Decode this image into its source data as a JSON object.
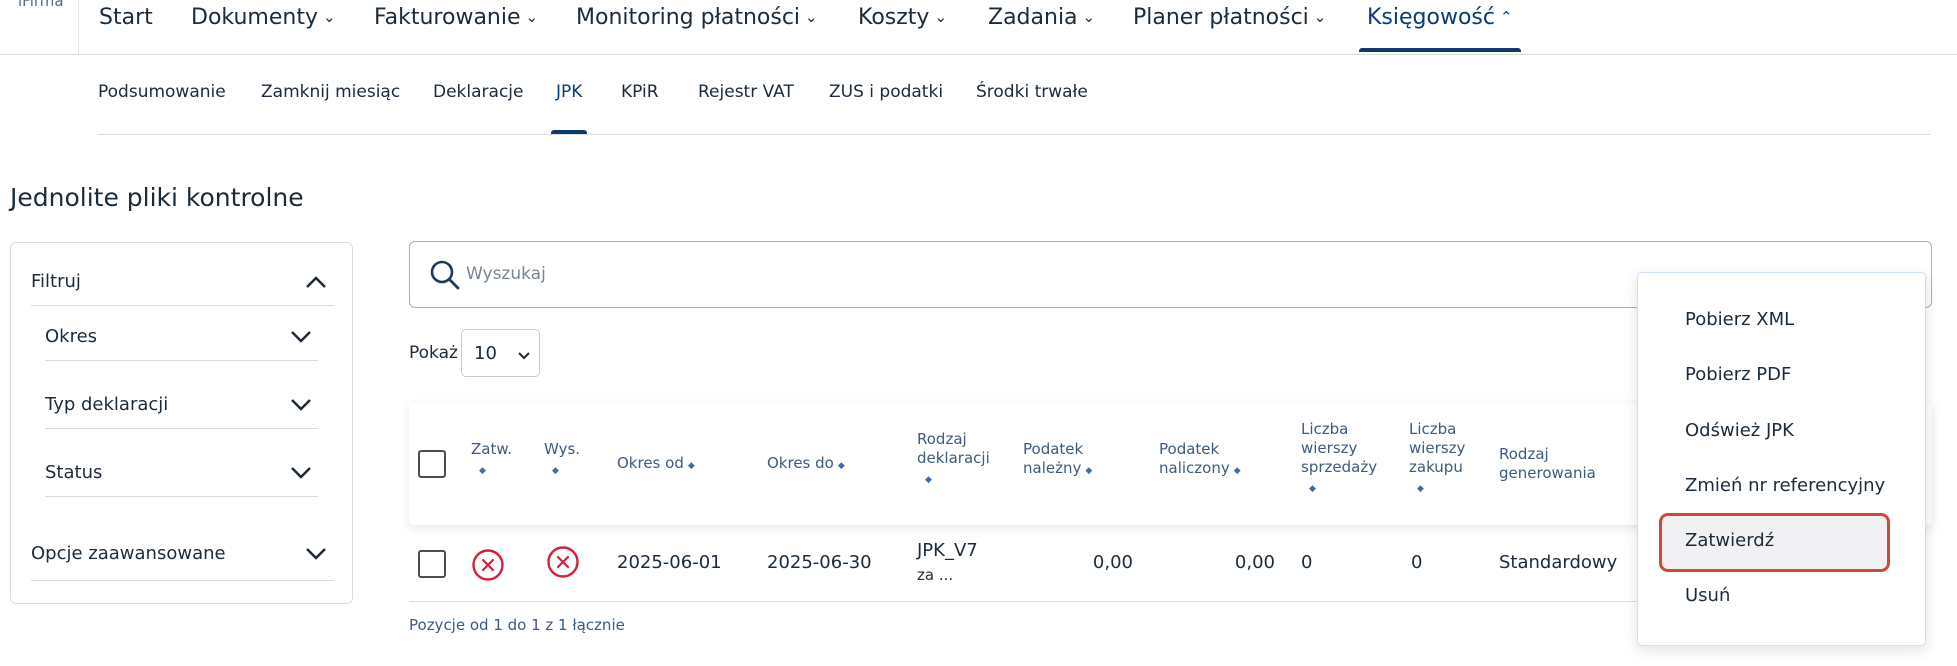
{
  "brand": {
    "text": "iFirma"
  },
  "top_nav": [
    {
      "label": "Start",
      "has_chevron": false
    },
    {
      "label": "Dokumenty",
      "has_chevron": true
    },
    {
      "label": "Fakturowanie",
      "has_chevron": true
    },
    {
      "label": "Monitoring płatności",
      "has_chevron": true
    },
    {
      "label": "Koszty",
      "has_chevron": true
    },
    {
      "label": "Zadania",
      "has_chevron": true
    },
    {
      "label": "Planer płatności",
      "has_chevron": true
    },
    {
      "label": "Księgowość",
      "has_chevron": true,
      "active": true
    }
  ],
  "sub_nav": [
    {
      "label": "Podsumowanie"
    },
    {
      "label": "Zamknij miesiąc"
    },
    {
      "label": "Deklaracje"
    },
    {
      "label": "JPK",
      "active": true
    },
    {
      "label": "KPiR"
    },
    {
      "label": "Rejestr VAT"
    },
    {
      "label": "ZUS i podatki"
    },
    {
      "label": "Środki trwałe"
    }
  ],
  "page_title": "Jednolite pliki kontrolne",
  "filter": {
    "title": "Filtruj",
    "items": [
      {
        "label": "Okres"
      },
      {
        "label": "Typ deklaracji"
      },
      {
        "label": "Status"
      }
    ],
    "advanced": "Opcje zaawansowane"
  },
  "search": {
    "placeholder": "Wyszukaj",
    "value": ""
  },
  "page_size": {
    "label": "Pokaż",
    "value": "10"
  },
  "table": {
    "columns": [
      {
        "label": "Zatw.",
        "sortable": true
      },
      {
        "label": "Wys.",
        "sortable": true
      },
      {
        "label": "Okres od",
        "sortable": true
      },
      {
        "label": "Okres do",
        "sortable": true
      },
      {
        "label": "Rodzaj deklaracji",
        "sortable": true
      },
      {
        "label": "Podatek należny",
        "sortable": true
      },
      {
        "label": "Podatek naliczony",
        "sortable": true
      },
      {
        "label": "Liczba wierszy sprzedaży",
        "sortable": true
      },
      {
        "label": "Liczba wierszy zakupu",
        "sortable": true
      },
      {
        "label": "Rodzaj generowania",
        "sortable": false
      }
    ],
    "rows": [
      {
        "approved_icon": "x-circle-icon",
        "sent_icon": "x-circle-icon",
        "period_from": "2025-06-01",
        "period_to": "2025-06-30",
        "declaration_type": "JPK_V7",
        "declaration_type_cont": "za ...",
        "tax_due": "0,00",
        "tax_input": "0,00",
        "sales_rows": "0",
        "purchase_rows": "0",
        "generation_type": "Standardowy"
      }
    ]
  },
  "pagination_info": "Pozycje od 1 do 1 z 1 łącznie",
  "actions_menu": {
    "items": [
      {
        "label": "Pobierz XML"
      },
      {
        "label": "Pobierz PDF"
      },
      {
        "label": "Odśwież JPK"
      },
      {
        "label": "Zmień nr referencyjny"
      },
      {
        "label": "Zatwierdź",
        "highlighted": true
      },
      {
        "label": "Usuń"
      }
    ]
  },
  "colors": {
    "accent": "#10386b",
    "error": "#d0233a",
    "highlight_border": "#cc4a3a"
  }
}
